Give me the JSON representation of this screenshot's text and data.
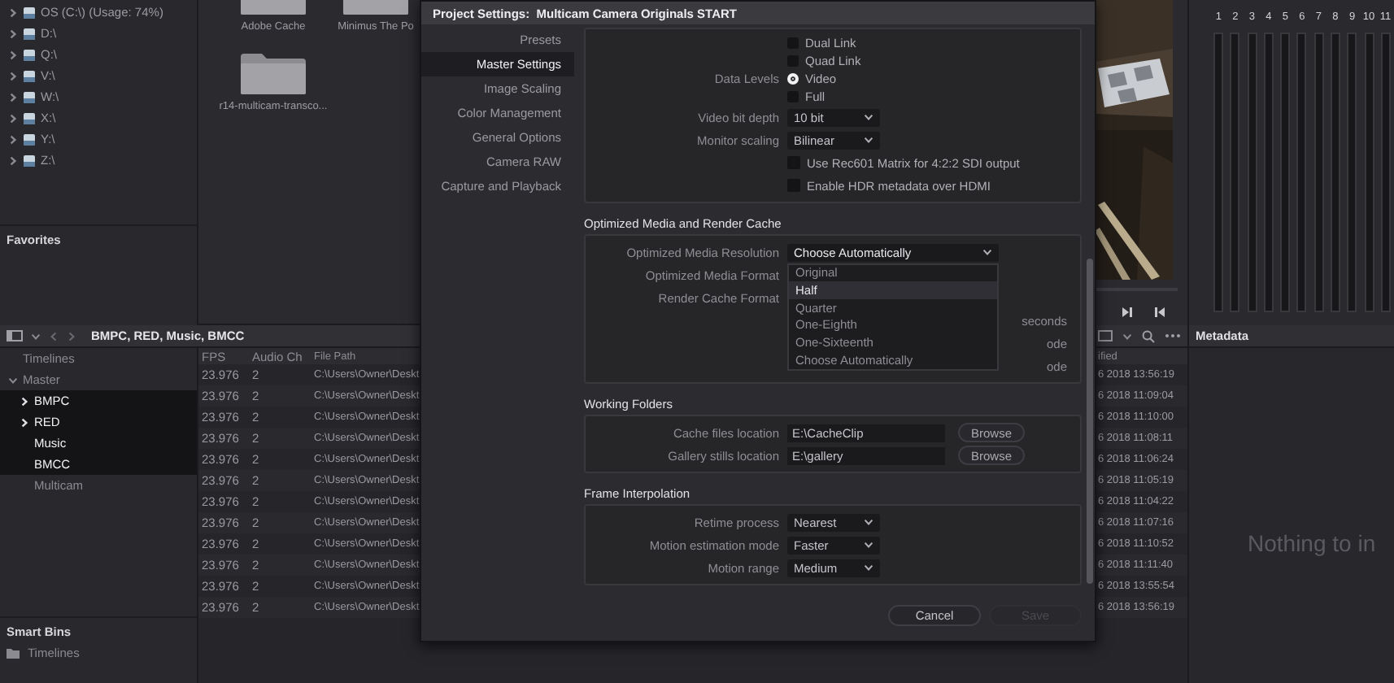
{
  "drives": [
    {
      "label": "OS (C:\\) (Usage: 74%)",
      "expanded": false
    },
    {
      "label": "D:\\",
      "expanded": false
    },
    {
      "label": "Q:\\",
      "expanded": false
    },
    {
      "label": "V:\\",
      "expanded": false
    },
    {
      "label": "W:\\",
      "expanded": false
    },
    {
      "label": "X:\\",
      "expanded": false
    },
    {
      "label": "Y:\\",
      "expanded": false
    },
    {
      "label": "Z:\\",
      "expanded": false
    }
  ],
  "favorites": {
    "title": "Favorites"
  },
  "folders": [
    {
      "name": "Adobe Cache"
    },
    {
      "name": "Minimus The Po"
    },
    {
      "name": "r14-multicam-transco..."
    }
  ],
  "bin_bar": {
    "path": "BMPC, RED, Music, BMCC"
  },
  "bins": [
    {
      "label": "Timelines",
      "selected": false
    },
    {
      "label": "Master",
      "selected": false,
      "expanded": true,
      "children": [
        {
          "label": "BMPC",
          "selected": true,
          "expanded": false
        },
        {
          "label": "RED",
          "selected": true,
          "expanded": false
        },
        {
          "label": "Music",
          "selected": true
        },
        {
          "label": "BMCC",
          "selected": true
        },
        {
          "label": "Multicam",
          "selected": false
        }
      ]
    }
  ],
  "smart_bins": {
    "title": "Smart Bins",
    "items": [
      {
        "label": "Timelines"
      }
    ]
  },
  "table": {
    "columns": [
      "FPS",
      "Audio Ch",
      "File Path",
      "ified"
    ],
    "rows": [
      {
        "fps": "23.976",
        "audio_ch": "2",
        "file_path": "C:\\Users\\Owner\\Deskt",
        "column_4": "6 2018 13:56:19"
      },
      {
        "fps": "23.976",
        "audio_ch": "2",
        "file_path": "C:\\Users\\Owner\\Deskt",
        "column_4": "6 2018 11:09:04"
      },
      {
        "fps": "23.976",
        "audio_ch": "2",
        "file_path": "C:\\Users\\Owner\\Deskt",
        "column_4": "6 2018 11:10:00"
      },
      {
        "fps": "23.976",
        "audio_ch": "2",
        "file_path": "C:\\Users\\Owner\\Deskt",
        "column_4": "6 2018 11:08:11"
      },
      {
        "fps": "23.976",
        "audio_ch": "2",
        "file_path": "C:\\Users\\Owner\\Deskt",
        "column_4": "6 2018 11:06:24"
      },
      {
        "fps": "23.976",
        "audio_ch": "2",
        "file_path": "C:\\Users\\Owner\\Deskt",
        "column_4": "6 2018 11:05:19"
      },
      {
        "fps": "23.976",
        "audio_ch": "2",
        "file_path": "C:\\Users\\Owner\\Deskt",
        "column_4": "6 2018 11:04:22"
      },
      {
        "fps": "23.976",
        "audio_ch": "2",
        "file_path": "C:\\Users\\Owner\\Deskt",
        "column_4": "6 2018 11:07:16"
      },
      {
        "fps": "23.976",
        "audio_ch": "2",
        "file_path": "C:\\Users\\Owner\\Deskt",
        "column_4": "6 2018 11:10:52"
      },
      {
        "fps": "23.976",
        "audio_ch": "2",
        "file_path": "C:\\Users\\Owner\\Deskt",
        "column_4": "6 2018 11:11:40"
      },
      {
        "fps": "23.976",
        "audio_ch": "2",
        "file_path": "C:\\Users\\Owner\\Deskt",
        "column_4": "6 2018 13:55:54"
      },
      {
        "fps": "23.976",
        "audio_ch": "2",
        "file_path": "C:\\Users\\Owner\\Deskt",
        "column_4": "6 2018 13:56:19"
      }
    ]
  },
  "audio_meters": {
    "channels": [
      "1",
      "2",
      "3",
      "4",
      "5",
      "6",
      "7",
      "8",
      "9",
      "10",
      "11"
    ]
  },
  "metadata": {
    "title": "Metadata",
    "message": "Nothing to in"
  },
  "dialog": {
    "title": "Project Settings:  Multicam Camera Originals START",
    "nav": [
      {
        "label": "Presets",
        "selected": false
      },
      {
        "label": "Master Settings",
        "selected": true
      },
      {
        "label": "Image Scaling",
        "selected": false
      },
      {
        "label": "Color Management",
        "selected": false
      },
      {
        "label": "General Options",
        "selected": false
      },
      {
        "label": "Camera RAW",
        "selected": false
      },
      {
        "label": "Capture and Playback",
        "selected": false
      }
    ],
    "sections": [
      {
        "rows": [
          {
            "kind": "option",
            "text": "Dual Link",
            "selected": false
          },
          {
            "kind": "option",
            "text": "Quad Link",
            "selected": false
          },
          {
            "kind": "option",
            "label": "Data Levels",
            "text": "Video",
            "selected": true
          },
          {
            "kind": "option",
            "text": "Full",
            "selected": false
          },
          {
            "kind": "select",
            "label": "Video bit depth",
            "value": "10 bit"
          },
          {
            "kind": "select",
            "label": "Monitor scaling",
            "value": "Bilinear"
          },
          {
            "kind": "check",
            "text": "Use Rec601 Matrix for 4:2:2 SDI output",
            "checked": false
          },
          {
            "kind": "check",
            "text": "Enable HDR metadata over HDMI",
            "checked": false
          }
        ]
      },
      {
        "title": "Optimized Media and Render Cache",
        "rows": [
          {
            "kind": "select",
            "label": "Optimized Media Resolution",
            "value": "Choose Automatically",
            "menu": [
              {
                "label": "Original",
                "highlighted": false
              },
              {
                "label": "Half",
                "highlighted": true
              },
              {
                "label": "Quarter",
                "highlighted": false
              },
              {
                "label": "One-Eighth",
                "highlighted": false
              },
              {
                "label": "One-Sixteenth",
                "highlighted": false
              },
              {
                "label": "Choose Automatically",
                "highlighted": false
              }
            ]
          },
          {
            "kind": "label",
            "label": "Optimized Media Format"
          },
          {
            "kind": "label",
            "label": "Render Cache Format"
          },
          {
            "kind": "trailing",
            "text": "seconds"
          },
          {
            "kind": "trailing",
            "text": "ode"
          },
          {
            "kind": "trailing",
            "text": "ode"
          }
        ]
      },
      {
        "title": "Working Folders",
        "rows": [
          {
            "kind": "path",
            "label": "Cache files location",
            "value": "E:\\CacheClip",
            "button": "Browse"
          },
          {
            "kind": "path",
            "label": "Gallery stills location",
            "value": "E:\\gallery",
            "button": "Browse"
          }
        ]
      },
      {
        "title": "Frame Interpolation",
        "rows": [
          {
            "kind": "select",
            "label": "Retime process",
            "value": "Nearest"
          },
          {
            "kind": "select",
            "label": "Motion estimation mode",
            "value": "Faster"
          },
          {
            "kind": "select",
            "label": "Motion range",
            "value": "Medium"
          }
        ]
      }
    ],
    "buttons": [
      {
        "label": "Cancel",
        "disabled": false
      },
      {
        "label": "Save",
        "disabled": true
      }
    ]
  }
}
